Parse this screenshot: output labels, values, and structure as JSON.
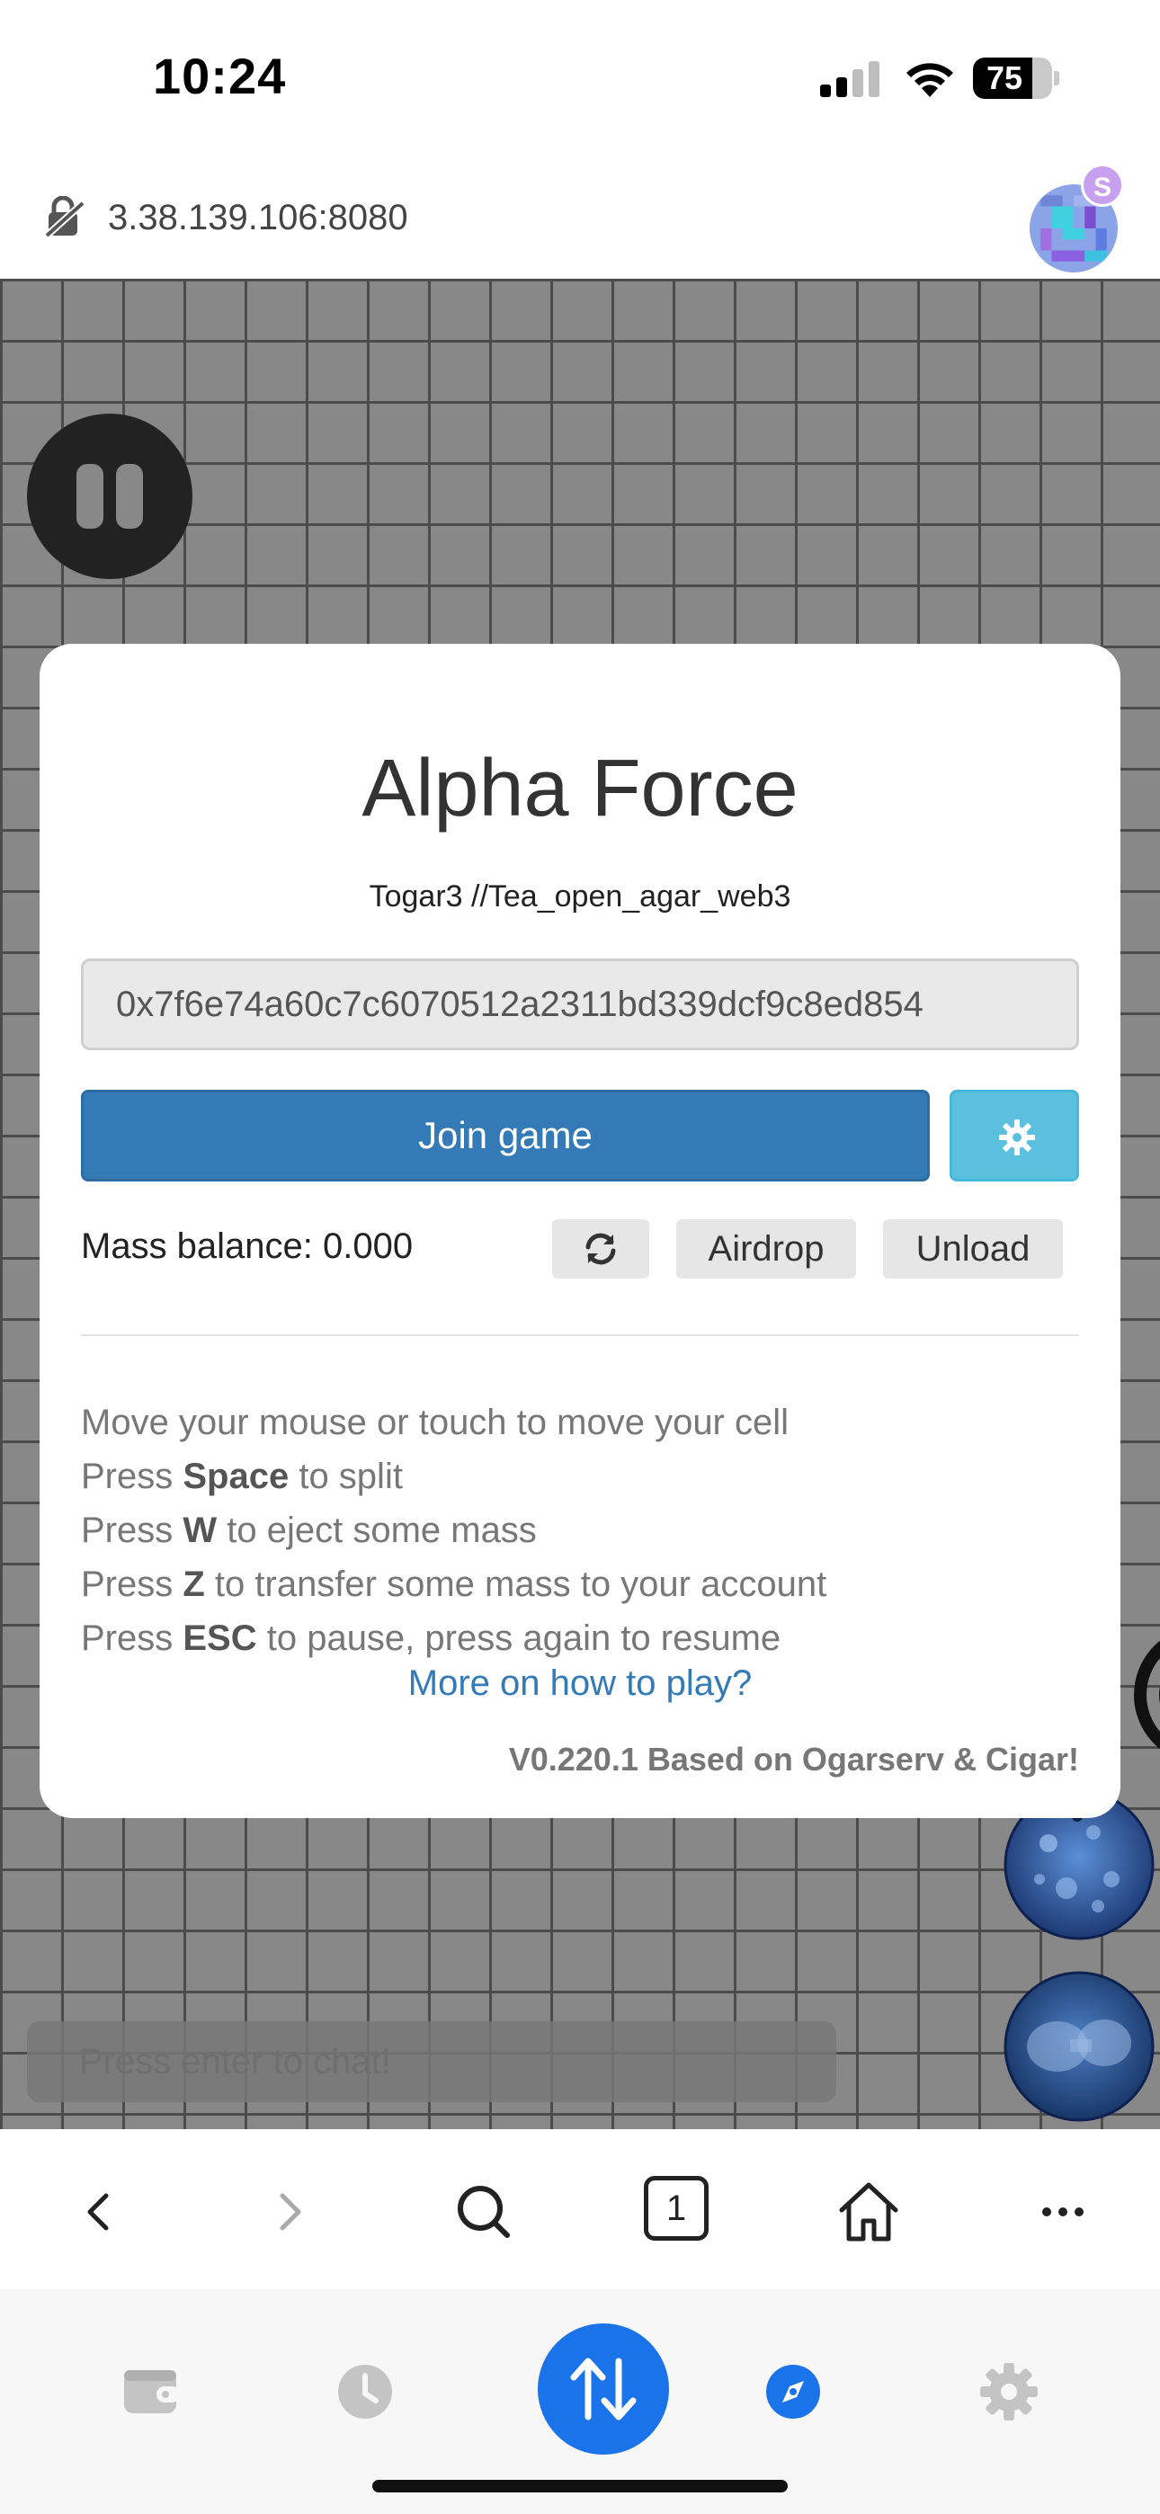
{
  "status_bar": {
    "time": "10:24",
    "battery_level": "75",
    "battery_fraction": 0.75
  },
  "browser": {
    "url": "3.38.139.106:8080",
    "avatar_badge": "S",
    "tab_count": "1"
  },
  "game": {
    "chat_placeholder": "Press enter to chat!"
  },
  "modal": {
    "title": "Alpha Force",
    "subtitle": "Togar3 //Tea_open_agar_web3",
    "wallet_address": "0x7f6e74a60c7c6070512a2311bd339dcf9c8ed854",
    "join_label": "Join game",
    "mass_balance": "Mass balance: 0.000",
    "airdrop_label": "Airdrop",
    "unload_label": "Unload",
    "instructions": {
      "line1": "Move your mouse or touch to move your cell",
      "line2_pre": "Press ",
      "line2_key": "Space",
      "line2_post": " to split",
      "line3_pre": "Press ",
      "line3_key": "W",
      "line3_post": " to eject some mass",
      "line4_pre": "Press ",
      "line4_key": "Z",
      "line4_post": " to transfer some mass to your account",
      "line5_pre": "Press ",
      "line5_key": "ESC",
      "line5_post": " to pause, press again to resume"
    },
    "how_to_play_link": "More on how to play?",
    "version": "V0.220.1 Based on Ogarserv & Cigar!"
  },
  "icons": {
    "status": [
      "signal-icon",
      "wifi-icon",
      "battery-icon"
    ],
    "url_bar": [
      "insecure-lock-icon",
      "avatar"
    ],
    "toolbar": [
      "back-icon",
      "forward-icon",
      "search-icon",
      "tabs-icon",
      "home-icon",
      "more-icon"
    ],
    "tabbar": [
      "wallet-icon",
      "history-icon",
      "swap-icon",
      "browser-compass-icon",
      "settings-gear-icon"
    ]
  },
  "colors": {
    "primary": "#337ab7",
    "info": "#5bc0de",
    "tab_accent": "#1a73e8"
  }
}
